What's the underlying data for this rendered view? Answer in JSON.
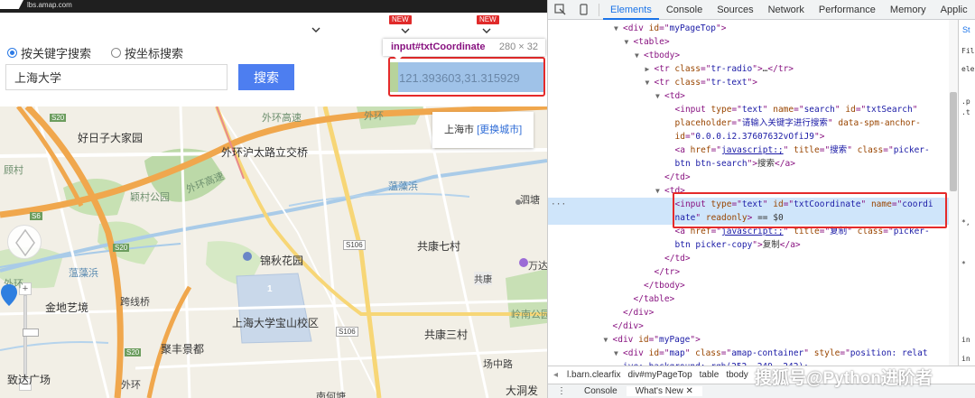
{
  "site": {
    "url_label": "lbs.amap.com",
    "new_badges": [
      "NEW",
      "NEW"
    ]
  },
  "search_form": {
    "radio_keyword": "按关键字搜索",
    "radio_coordinate": "按坐标搜索",
    "keyword_value": "上海大学",
    "search_button": "搜索",
    "coordinate_value": "121.393603,31.315929"
  },
  "inspect_tooltip": {
    "selector": "input#txtCoordinate",
    "dims": "280 × 32"
  },
  "map": {
    "city": "上海市",
    "change_city": "[更换城市]",
    "labels": {
      "l1": "好日子大家园",
      "l2": "外环沪太路立交桥",
      "l3": "外环高速",
      "l4": "颖村公园",
      "l5": "蕰藻浜",
      "l6": "S106",
      "l7": "共康七村",
      "l8": "锦秋花园",
      "l9": "跨线桥",
      "l10": "金地艺境",
      "l11": "上海大学宝山校区",
      "l12": "聚丰景都",
      "l13": "共康三村",
      "l14": "场中路",
      "l15": "大洞发",
      "l16": "岭南公园",
      "l17": "共康",
      "l18": "泗塘",
      "l19": "万达",
      "l20": "S20",
      "l21": "外环",
      "l22": "S106",
      "l23": "致达广场",
      "l24": "南何塘",
      "l25": "外环",
      "l26": "S20",
      "l27": "外环高速",
      "l28": "蕰藻浜",
      "l29": "S6",
      "l30": "S20",
      "l31": "外环",
      "l32": "顾村"
    },
    "marker_number": "1"
  },
  "devtools": {
    "tabs": [
      "Elements",
      "Console",
      "Sources",
      "Network",
      "Performance",
      "Memory",
      "Applic"
    ],
    "active_tab": "Elements",
    "dom_lines": [
      {
        "indent": 6,
        "tw": "▼",
        "parts": [
          [
            "t",
            "<div "
          ],
          [
            "a",
            "id"
          ],
          [
            "t",
            "=\""
          ],
          [
            "v",
            "myPageTop"
          ],
          [
            "t",
            "\">"
          ]
        ]
      },
      {
        "indent": 7,
        "tw": "▼",
        "parts": [
          [
            "t",
            "<table>"
          ]
        ]
      },
      {
        "indent": 8,
        "tw": "▼",
        "parts": [
          [
            "t",
            "<tbody>"
          ]
        ]
      },
      {
        "indent": 9,
        "tw": "▶",
        "parts": [
          [
            "t",
            "<tr "
          ],
          [
            "a",
            "class"
          ],
          [
            "t",
            "=\""
          ],
          [
            "v",
            "tr-radio"
          ],
          [
            "t",
            "\">"
          ],
          [
            "x",
            "…"
          ],
          [
            "t",
            "</tr>"
          ]
        ]
      },
      {
        "indent": 9,
        "tw": "▼",
        "parts": [
          [
            "t",
            "<tr "
          ],
          [
            "a",
            "class"
          ],
          [
            "t",
            "=\""
          ],
          [
            "v",
            "tr-text"
          ],
          [
            "t",
            "\">"
          ]
        ]
      },
      {
        "indent": 10,
        "tw": "▼",
        "parts": [
          [
            "t",
            "<td>"
          ]
        ]
      },
      {
        "indent": 11,
        "tw": "",
        "parts": [
          [
            "t",
            "<input "
          ],
          [
            "a",
            "type"
          ],
          [
            "t",
            "=\""
          ],
          [
            "v",
            "text"
          ],
          [
            "t",
            "\" "
          ],
          [
            "a",
            "name"
          ],
          [
            "t",
            "=\""
          ],
          [
            "v",
            "search"
          ],
          [
            "t",
            "\" "
          ],
          [
            "a",
            "id"
          ],
          [
            "t",
            "=\""
          ],
          [
            "v",
            "txtSearch"
          ],
          [
            "t",
            "\""
          ]
        ]
      },
      {
        "indent": 11,
        "tw": "",
        "parts": [
          [
            "a",
            "placeholder"
          ],
          [
            "t",
            "=\""
          ],
          [
            "v",
            "请输入关键字进行搜索"
          ],
          [
            "t",
            "\" "
          ],
          [
            "a",
            "data-spm-anchor-"
          ]
        ]
      },
      {
        "indent": 11,
        "tw": "",
        "parts": [
          [
            "a",
            "id"
          ],
          [
            "t",
            "=\""
          ],
          [
            "v",
            "0.0.0.i2.37607632vOfiJ9"
          ],
          [
            "t",
            "\">"
          ]
        ]
      },
      {
        "indent": 11,
        "tw": "",
        "parts": [
          [
            "t",
            "<a "
          ],
          [
            "a",
            "href"
          ],
          [
            "t",
            "=\""
          ],
          [
            "l",
            "javascript:;"
          ],
          [
            "t",
            "\" "
          ],
          [
            "a",
            "title"
          ],
          [
            "t",
            "=\""
          ],
          [
            "v",
            "搜索"
          ],
          [
            "t",
            "\" "
          ],
          [
            "a",
            "class"
          ],
          [
            "t",
            "=\""
          ],
          [
            "v",
            "picker-"
          ]
        ]
      },
      {
        "indent": 11,
        "tw": "",
        "parts": [
          [
            "v",
            "btn btn-search"
          ],
          [
            "t",
            "\">"
          ],
          [
            "x",
            "搜索"
          ],
          [
            "t",
            "</a>"
          ]
        ]
      },
      {
        "indent": 10,
        "tw": "",
        "parts": [
          [
            "t",
            "</td>"
          ]
        ]
      },
      {
        "indent": 10,
        "tw": "▼",
        "parts": [
          [
            "t",
            "<td>"
          ]
        ]
      },
      {
        "indent": 11,
        "tw": "",
        "sel": true,
        "parts": [
          [
            "t",
            "<input "
          ],
          [
            "a",
            "type"
          ],
          [
            "t",
            "=\""
          ],
          [
            "v",
            "text"
          ],
          [
            "t",
            "\" "
          ],
          [
            "a",
            "id"
          ],
          [
            "t",
            "=\""
          ],
          [
            "v",
            "txtCoordinate"
          ],
          [
            "t",
            "\" "
          ],
          [
            "a",
            "name"
          ],
          [
            "t",
            "=\""
          ],
          [
            "v",
            "coordi"
          ]
        ]
      },
      {
        "indent": 11,
        "tw": "",
        "sel": true,
        "parts": [
          [
            "v",
            "nate"
          ],
          [
            "t",
            "\" "
          ],
          [
            "a",
            "readonly"
          ],
          [
            "t",
            "> "
          ],
          [
            "x",
            "== $0"
          ]
        ]
      },
      {
        "indent": 11,
        "tw": "",
        "parts": [
          [
            "t",
            "<a "
          ],
          [
            "a",
            "href"
          ],
          [
            "t",
            "=\""
          ],
          [
            "l",
            "javascript:;"
          ],
          [
            "t",
            "\" "
          ],
          [
            "a",
            "title"
          ],
          [
            "t",
            "=\""
          ],
          [
            "v",
            "复制"
          ],
          [
            "t",
            "\" "
          ],
          [
            "a",
            "class"
          ],
          [
            "t",
            "=\""
          ],
          [
            "v",
            "picker-"
          ]
        ]
      },
      {
        "indent": 11,
        "tw": "",
        "parts": [
          [
            "v",
            "btn picker-copy"
          ],
          [
            "t",
            "\">"
          ],
          [
            "x",
            "复制"
          ],
          [
            "t",
            "</a>"
          ]
        ]
      },
      {
        "indent": 10,
        "tw": "",
        "parts": [
          [
            "t",
            "</td>"
          ]
        ]
      },
      {
        "indent": 9,
        "tw": "",
        "parts": [
          [
            "t",
            "</tr>"
          ]
        ]
      },
      {
        "indent": 8,
        "tw": "",
        "parts": [
          [
            "t",
            "</tbody>"
          ]
        ]
      },
      {
        "indent": 7,
        "tw": "",
        "parts": [
          [
            "t",
            "</table>"
          ]
        ]
      },
      {
        "indent": 6,
        "tw": "",
        "parts": [
          [
            "t",
            "</div>"
          ]
        ]
      },
      {
        "indent": 5,
        "tw": "",
        "parts": [
          [
            "t",
            "</div>"
          ]
        ]
      },
      {
        "indent": 5,
        "tw": "▼",
        "parts": [
          [
            "t",
            "<div "
          ],
          [
            "a",
            "id"
          ],
          [
            "t",
            "=\""
          ],
          [
            "v",
            "myPage"
          ],
          [
            "t",
            "\">"
          ]
        ]
      },
      {
        "indent": 6,
        "tw": "▼",
        "parts": [
          [
            "t",
            "<div "
          ],
          [
            "a",
            "id"
          ],
          [
            "t",
            "=\""
          ],
          [
            "v",
            "map"
          ],
          [
            "t",
            "\" "
          ],
          [
            "a",
            "class"
          ],
          [
            "t",
            "=\""
          ],
          [
            "v",
            "amap-container"
          ],
          [
            "t",
            "\" "
          ],
          [
            "a",
            "style"
          ],
          [
            "t",
            "=\""
          ],
          [
            "v",
            "position: relat"
          ]
        ]
      },
      {
        "indent": 6,
        "tw": "",
        "parts": [
          [
            "v",
            "ive; background: rgb(252, 249, 242);"
          ]
        ]
      }
    ],
    "styles_tab": "St",
    "styles_snippets": [
      "Fil",
      "ele",
      ".p",
      ".t",
      "*,",
      "*",
      "in",
      "in"
    ],
    "breadcrumbs": [
      "l.barn.clearfix",
      "div#myPageTop",
      "table",
      "tbody"
    ],
    "drawer_tabs": [
      "Console",
      "What's New ✕"
    ]
  },
  "watermark": "搜狐号@Python进阶者"
}
